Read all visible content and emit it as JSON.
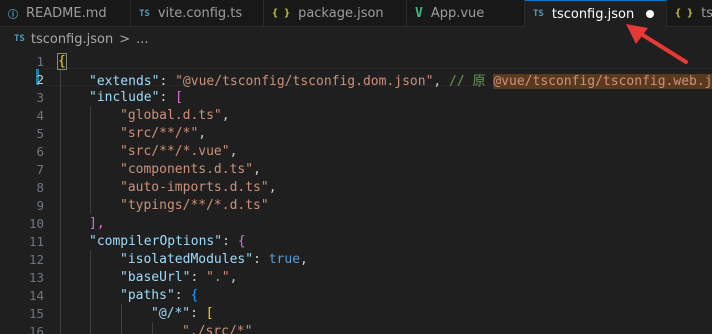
{
  "tabs": [
    {
      "icon": "info-icon",
      "label": "README.md",
      "active": false
    },
    {
      "icon": "typescript-icon",
      "label": "vite.config.ts",
      "active": false
    },
    {
      "icon": "json-icon",
      "label": "package.json",
      "active": false
    },
    {
      "icon": "vue-icon",
      "label": "App.vue",
      "active": false
    },
    {
      "icon": "typescript-icon",
      "label": "tsconfig.json",
      "active": true,
      "modified": true
    },
    {
      "icon": "json-icon",
      "label": "ts",
      "active": false
    }
  ],
  "tab_icon_glyphs": {
    "info": "ⓘ",
    "ts": "TS",
    "json": "{ }",
    "vue": "V"
  },
  "breadcrumb": {
    "icon": "TS",
    "file": "tsconfig.json",
    "separator": ">",
    "more": "..."
  },
  "line_numbers": [
    "1",
    "2",
    "3",
    "4",
    "5",
    "6",
    "7",
    "8",
    "9",
    "10",
    "11",
    "12",
    "13",
    "14",
    "15",
    "16"
  ],
  "code": {
    "l1": "{",
    "l2_key": "\"extends\"",
    "l2_colon": ": ",
    "l2_val": "\"@vue/tsconfig/tsconfig.dom.json\"",
    "l2_comma": ", ",
    "l2_comment": "// 原 ",
    "l2_highlight": "@vue/tsconfig/tsconfig.web.json",
    "l3_key": "\"include\"",
    "l3_colon": ": ",
    "l3_bracket": "[",
    "l4": "\"global.d.ts\"",
    "l5": "\"src/**/*\"",
    "l6": "\"src/**/*.vue\"",
    "l7": "\"components.d.ts\"",
    "l8": "\"auto-imports.d.ts\"",
    "l9": "\"typings/**/*.d.ts\"",
    "l10": "],",
    "l11_key": "\"compilerOptions\"",
    "l11_colon": ": ",
    "l11_brace": "{",
    "l12_key": "\"isolatedModules\"",
    "l12_colon": ": ",
    "l12_val": "true",
    "l13_key": "\"baseUrl\"",
    "l13_colon": ": ",
    "l13_val": "\".\"",
    "l14_key": "\"paths\"",
    "l14_colon": ": ",
    "l14_brace": "{",
    "l15_key": "\"@/*\"",
    "l15_colon": ": ",
    "l15_bracket": "[",
    "l16_val": "\"./src/*\"",
    "comma": ","
  },
  "colors": {
    "accent": "#0078d4",
    "annotation_arrow": "#e53935",
    "string": "#ce9178",
    "key": "#9cdcfe",
    "keyword": "#569cd6"
  }
}
